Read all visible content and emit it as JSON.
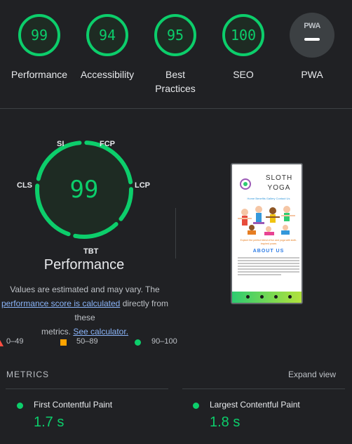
{
  "categories": [
    {
      "label": "Performance",
      "score": "99",
      "value": 0.99
    },
    {
      "label": "Accessibility",
      "score": "94",
      "value": 0.94
    },
    {
      "label": "Best Practices",
      "score": "95",
      "value": 0.95
    },
    {
      "label": "SEO",
      "score": "100",
      "value": 1.0
    },
    {
      "label": "PWA",
      "badge": "PWA"
    }
  ],
  "main_gauge": {
    "score": "99",
    "value": 0.99,
    "title": "Performance",
    "metric_tags": {
      "si": "SI",
      "fcp": "FCP",
      "lcp": "LCP",
      "tbt": "TBT",
      "cls": "CLS"
    }
  },
  "estimate": {
    "line1": "Values are estimated and may vary. The",
    "link1": "performance score is calculated",
    "text2": "directly from these",
    "text3": "metrics.",
    "link2": "See calculator."
  },
  "legend": {
    "fail": "0–49",
    "average": "50–89",
    "pass": "90–100"
  },
  "thumbnail": {
    "title_line1": "SLOTH",
    "title_line2": "YOGA",
    "nav": "Home   Benefits   Gallery   Contact Us",
    "caption": "Explore the perfect blend of fun and yoga with sloth-inspired poses",
    "about": "ABOUT US"
  },
  "metrics": {
    "title": "METRICS",
    "expand_label": "Expand view",
    "items": [
      {
        "name": "First Contentful Paint",
        "value": "1.7 s"
      },
      {
        "name": "Largest Contentful Paint",
        "value": "1.8 s"
      }
    ]
  },
  "colors": {
    "pass": "#0cce6b",
    "average": "#ffa400",
    "fail": "#ff4e42",
    "background": "#202124",
    "link": "#8ab4f8"
  }
}
